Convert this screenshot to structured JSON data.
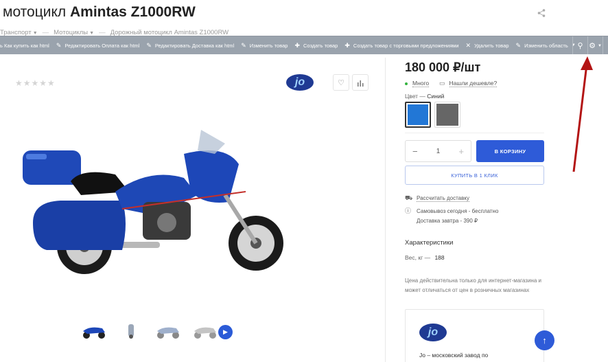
{
  "product": {
    "title_prefix": "мотоцикл",
    "title_name": "Amintas Z1000RW",
    "price": "180 000 ₽/шт",
    "stock": "Много",
    "cheaper_link": "Нашли дешевле?",
    "rating_stars": "★★★★★",
    "brand_logo_text": "jo"
  },
  "breadcrumbs": [
    {
      "label": "Транспорт"
    },
    {
      "label": "Мотоциклы"
    },
    {
      "label": "Дорожный мотоцикл Amintas Z1000RW"
    }
  ],
  "adminbar": {
    "items": [
      "ь Как купить как html",
      "Редактировать Оплата как html",
      "Редактировать Доставка как html",
      "Изменить товар",
      "Создать товар",
      "Создать товар с торговыми предложениями",
      "Удалить товар",
      "Изменить область"
    ]
  },
  "color": {
    "label": "Цвет",
    "selected": "Синий",
    "swatches": [
      "#2277d6",
      "#666666"
    ]
  },
  "cart": {
    "quantity": "1",
    "minus": "−",
    "plus": "+",
    "buy_label": "В КОРЗИНУ",
    "oneclick_label": "КУПИТЬ В 1 КЛИК"
  },
  "delivery": {
    "calc_link": "Рассчитать доставку",
    "pickup_line": "Самовывоз сегодня - бесплатно",
    "courier_line": "Доставка завтра - 390 ₽"
  },
  "characteristics": {
    "title": "Характеристики",
    "weight_label": "Вес, кг",
    "weight_value": "188"
  },
  "note": "Цена действительна только для интернет-магазина и может отличаться от цен в розничных магазинах",
  "brand_card": {
    "logo_text": "jo",
    "text": "Jo – московский завод по"
  },
  "colors": {
    "accent": "#2e5bd8",
    "admin_bar": "#9aa3ad",
    "annotation_arrow": "#b31414"
  }
}
